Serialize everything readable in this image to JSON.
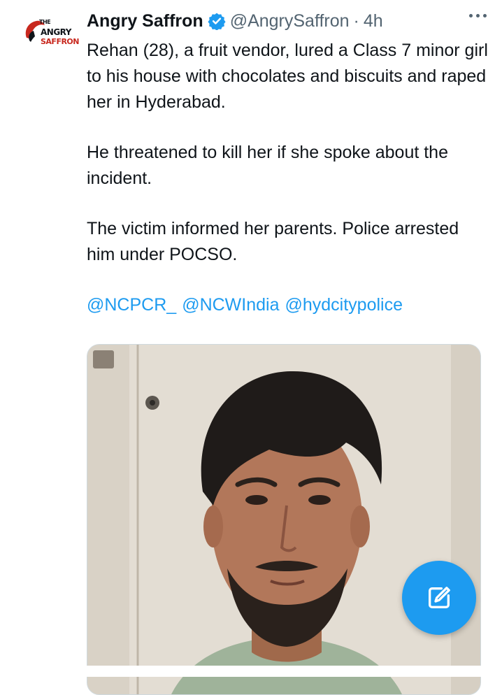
{
  "author": {
    "display_name": "Angry Saffron",
    "handle": "@AngrySaffron",
    "separator": "·",
    "time": "4h",
    "logo_words": [
      "THE",
      "ANGRY",
      "SAFFRON"
    ]
  },
  "tweet": {
    "paragraphs": [
      "Rehan (28), a fruit vendor, lured a Class 7 minor girl to his house with chocolates and biscuits and raped her in Hyderabad.",
      "He threatened to kill her if she spoke about the incident.",
      "The victim informed her parents. Police arrested him under POCSO."
    ],
    "mentions": [
      "@NCPCR_",
      "@NCWIndia",
      "@hydcitypolice"
    ]
  },
  "icons": {
    "verified": "verified-badge-icon",
    "more": "more-dots-icon",
    "compose": "compose-icon"
  },
  "colors": {
    "accent": "#1d9bf0",
    "text": "#0f1419",
    "muted": "#536471",
    "logo_red": "#c8281e"
  }
}
